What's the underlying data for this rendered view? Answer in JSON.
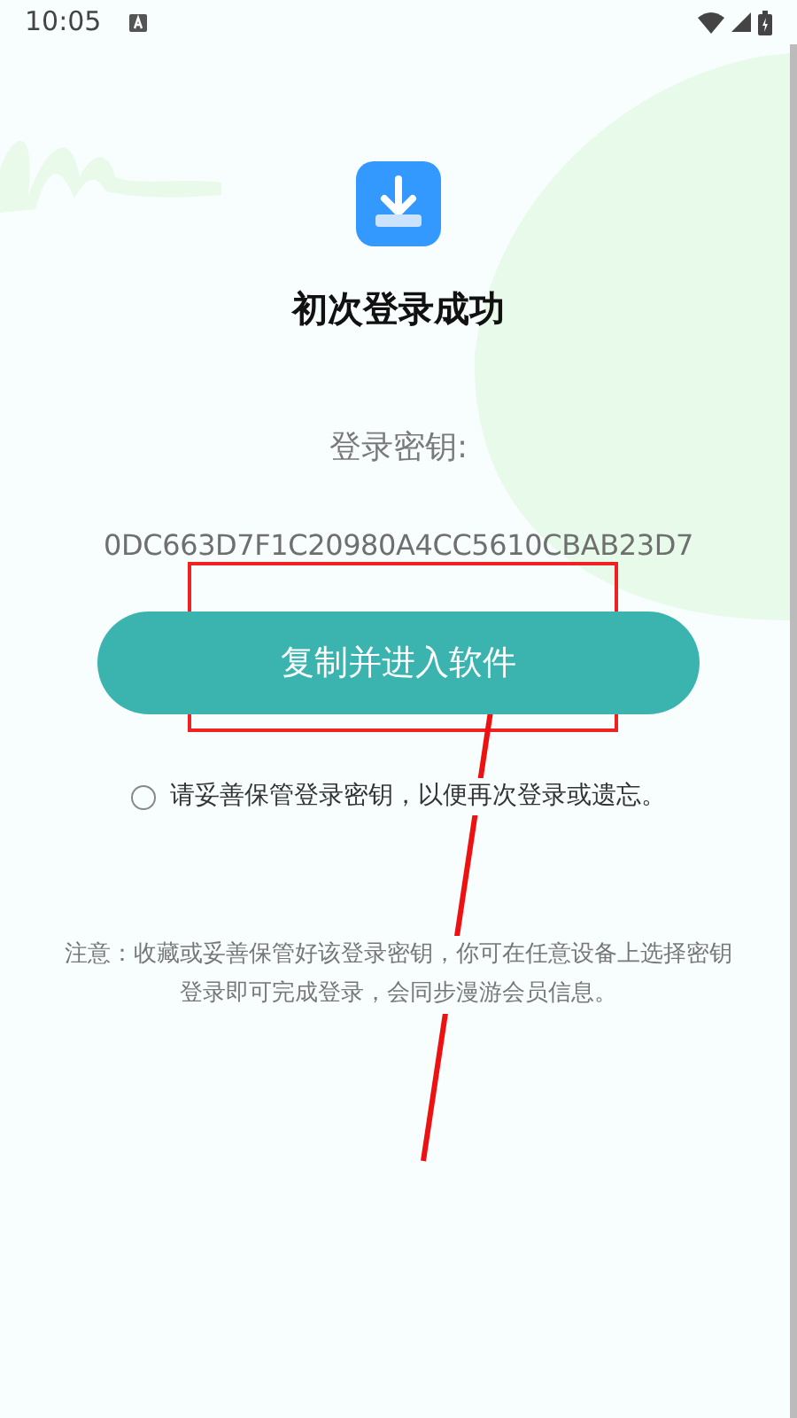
{
  "status_bar": {
    "time": "10:05"
  },
  "title": "初次登录成功",
  "key_label": "登录密钥:",
  "key_value": "0DC663D7F1C20980A4CC5610CBAB23D7",
  "primary_button": "复制并进入软件",
  "agreement": {
    "text": "请妥善保管登录密钥，以便再次登录或遗忘。",
    "checked": false
  },
  "note": "注意：收藏或妥善保管好该登录密钥，你可在任意设备上选择密钥登录即可完成登录，会同步漫游会员信息。"
}
